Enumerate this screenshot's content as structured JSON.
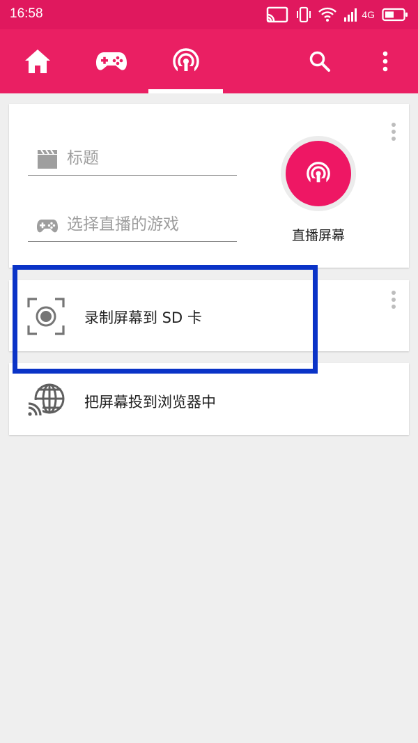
{
  "status_bar": {
    "time": "16:58",
    "network_label": "4G",
    "icons": [
      "cast-icon",
      "vibrate-icon",
      "wifi-icon",
      "signal-icon",
      "battery-icon"
    ]
  },
  "app_bar": {
    "tabs": [
      {
        "name": "home",
        "icon": "home-icon"
      },
      {
        "name": "games",
        "icon": "gamepad-icon"
      },
      {
        "name": "live",
        "icon": "broadcast-icon",
        "selected": true
      }
    ],
    "actions": [
      "search-icon",
      "more-vert-icon"
    ]
  },
  "live_card": {
    "title_placeholder": "标题",
    "game_placeholder": "选择直播的游戏",
    "live_button_label": "直播屏幕"
  },
  "record_card": {
    "label": "录制屏幕到 SD 卡"
  },
  "cast_card": {
    "label": "把屏幕投到浏览器中"
  },
  "colors": {
    "status_bar": "#e0185e",
    "app_bar": "#ea1f63",
    "accent": "#ee1764",
    "highlight_box": "#0a33c7",
    "background": "#efefef"
  }
}
